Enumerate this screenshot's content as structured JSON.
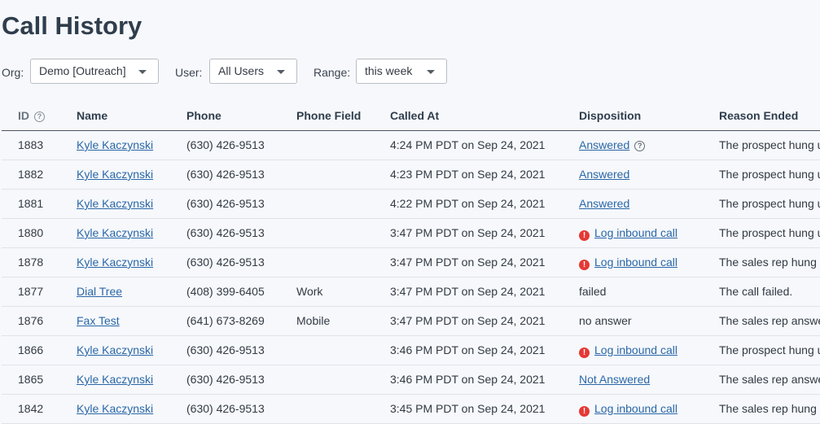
{
  "page": {
    "title": "Call History"
  },
  "filters": {
    "org_label": "Org:",
    "org_value": "Demo [Outreach]",
    "user_label": "User:",
    "user_value": "All Users",
    "range_label": "Range:",
    "range_value": "this week"
  },
  "table": {
    "headers": {
      "id": "ID",
      "name": "Name",
      "phone": "Phone",
      "phone_field": "Phone Field",
      "called_at": "Called At",
      "disposition": "Disposition",
      "reason_ended": "Reason Ended"
    },
    "rows": [
      {
        "id": "1883",
        "name": "Kyle Kaczynski",
        "phone": "(630) 426-9513",
        "phone_field": "",
        "called_at": "4:24 PM PDT on Sep 24, 2021",
        "disposition": "Answered",
        "reason": "The prospect hung up"
      },
      {
        "id": "1882",
        "name": "Kyle Kaczynski",
        "phone": "(630) 426-9513",
        "phone_field": "",
        "called_at": "4:23 PM PDT on Sep 24, 2021",
        "disposition": "Answered",
        "reason": "The prospect hung up"
      },
      {
        "id": "1881",
        "name": "Kyle Kaczynski",
        "phone": "(630) 426-9513",
        "phone_field": "",
        "called_at": "4:22 PM PDT on Sep 24, 2021",
        "disposition": "Answered",
        "reason": "The prospect hung up"
      },
      {
        "id": "1880",
        "name": "Kyle Kaczynski",
        "phone": "(630) 426-9513",
        "phone_field": "",
        "called_at": "3:47 PM PDT on Sep 24, 2021",
        "disposition": "Log inbound call",
        "reason": "The prospect hung up"
      },
      {
        "id": "1878",
        "name": "Kyle Kaczynski",
        "phone": "(630) 426-9513",
        "phone_field": "",
        "called_at": "3:47 PM PDT on Sep 24, 2021",
        "disposition": "Log inbound call",
        "reason": "The sales rep hung up"
      },
      {
        "id": "1877",
        "name": "Dial Tree",
        "phone": "(408) 399-6405",
        "phone_field": "Work",
        "called_at": "3:47 PM PDT on Sep 24, 2021",
        "disposition": "failed",
        "reason": "The call failed."
      },
      {
        "id": "1876",
        "name": "Fax Test",
        "phone": "(641) 673-8269",
        "phone_field": "Mobile",
        "called_at": "3:47 PM PDT on Sep 24, 2021",
        "disposition": "no answer",
        "reason": "The sales rep answered"
      },
      {
        "id": "1866",
        "name": "Kyle Kaczynski",
        "phone": "(630) 426-9513",
        "phone_field": "",
        "called_at": "3:46 PM PDT on Sep 24, 2021",
        "disposition": "Log inbound call",
        "reason": "The prospect hung up"
      },
      {
        "id": "1865",
        "name": "Kyle Kaczynski",
        "phone": "(630) 426-9513",
        "phone_field": "",
        "called_at": "3:46 PM PDT on Sep 24, 2021",
        "disposition": "Not Answered",
        "reason": "The sales rep answered"
      },
      {
        "id": "1842",
        "name": "Kyle Kaczynski",
        "phone": "(630) 426-9513",
        "phone_field": "",
        "called_at": "3:45 PM PDT on Sep 24, 2021",
        "disposition": "Log inbound call",
        "reason": "The sales rep hung up"
      }
    ]
  },
  "colors": {
    "background": "#f6f8fb",
    "link": "#2a67a8",
    "alert": "#e53935",
    "heading": "#2f3d4c"
  },
  "icons": {
    "id_header": "help-circle-icon",
    "answered_first": "help-circle-icon",
    "log_inbound": "alert-circle-icon",
    "select": "caret-down-icon"
  }
}
